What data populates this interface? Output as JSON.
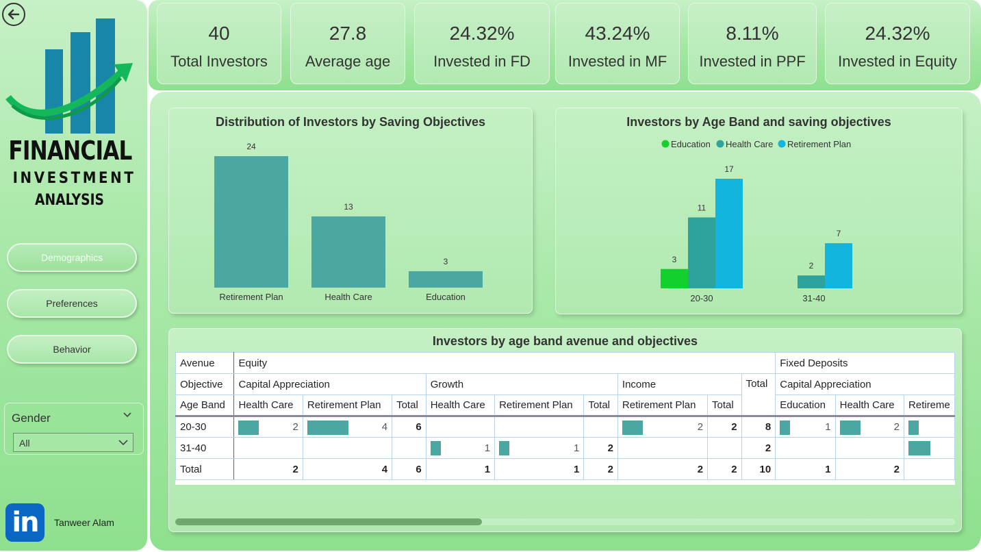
{
  "app": {
    "author": "Tanweer Alam",
    "logo_line1": "FINANCIAL",
    "logo_line2": "INVESTMENT",
    "logo_line3": "ANALYSIS"
  },
  "nav": {
    "demographics": "Demographics",
    "preferences": "Preferences",
    "behavior": "Behavior"
  },
  "slicer": {
    "title": "Gender",
    "value": "All"
  },
  "kpis": [
    {
      "value": "40",
      "label": "Total Investors"
    },
    {
      "value": "27.8",
      "label": "Average age"
    },
    {
      "value": "24.32%",
      "label": "Invested in FD"
    },
    {
      "value": "43.24%",
      "label": "Invested in MF"
    },
    {
      "value": "8.11%",
      "label": "Invested in PPF"
    },
    {
      "value": "24.32%",
      "label": "Invested in Equity"
    }
  ],
  "colors": {
    "teal": "#4aa7a2",
    "education": "#12d12d",
    "health_care": "#2ea39b",
    "retirement": "#12b5de"
  },
  "chart_data": [
    {
      "type": "bar",
      "title": "Distribution of Investors by Saving Objectives",
      "categories": [
        "Retirement Plan",
        "Health Care",
        "Education"
      ],
      "values": [
        24,
        13,
        3
      ]
    },
    {
      "type": "bar",
      "title": "Investors by Age Band and saving objectives",
      "categories": [
        "20-30",
        "31-40"
      ],
      "legend": "top-center",
      "series": [
        {
          "name": "Education",
          "values": [
            3,
            null
          ]
        },
        {
          "name": "Health Care",
          "values": [
            11,
            2
          ]
        },
        {
          "name": "Retirement Plan",
          "values": [
            17,
            7
          ]
        }
      ]
    }
  ],
  "table": {
    "title": "Investors by age band avenue and objectives",
    "row_headers": {
      "avenue": "Avenue",
      "objective": "Objective",
      "age_band": "Age Band"
    },
    "avenues": {
      "equity": "Equity",
      "fd": "Fixed Deposits"
    },
    "objectives": {
      "capital": "Capital Appreciation",
      "growth": "Growth",
      "income": "Income",
      "total": "Total",
      "fd_capital": "Capital Appreciation"
    },
    "columns": [
      "Health Care",
      "Retirement Plan",
      "Total",
      "Health Care",
      "Retirement Plan",
      "Total",
      "Retirement Plan",
      "Total",
      "Education",
      "Health Care",
      "Retireme"
    ],
    "rows": [
      {
        "label": "20-30",
        "cells": [
          "2",
          "4",
          "6",
          "",
          "",
          "",
          "2",
          "2",
          "8",
          "1",
          "2",
          ""
        ]
      },
      {
        "label": "31-40",
        "cells": [
          "",
          "",
          "",
          "1",
          "1",
          "2",
          "",
          "",
          "2",
          "",
          "",
          ""
        ]
      },
      {
        "label": "Total",
        "cells": [
          "2",
          "4",
          "6",
          "1",
          "1",
          "2",
          "2",
          "2",
          "10",
          "1",
          "2",
          ""
        ]
      }
    ],
    "bar_fractions": [
      [
        0.5,
        1.0,
        null,
        null,
        null,
        null,
        0.5,
        null,
        null,
        0.25,
        0.5,
        0.25
      ],
      [
        null,
        null,
        null,
        0.25,
        0.25,
        null,
        null,
        null,
        null,
        null,
        null,
        0.75
      ]
    ]
  }
}
